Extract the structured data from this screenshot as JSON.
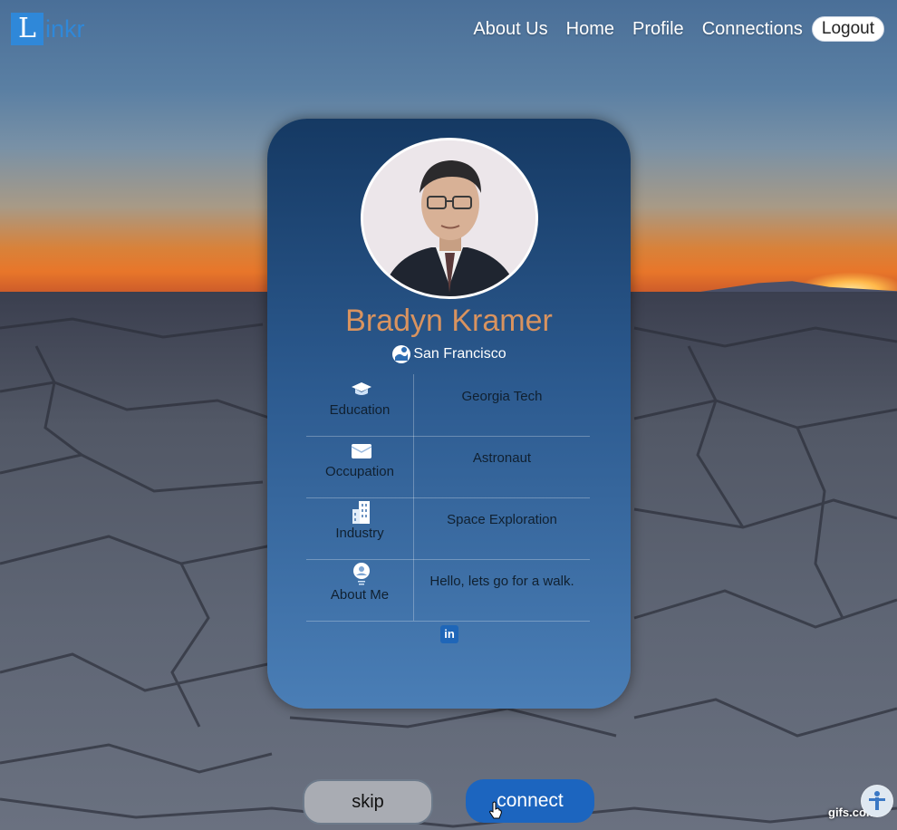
{
  "brand": {
    "letter": "L",
    "rest": "inkr"
  },
  "nav": {
    "links": [
      "About Us",
      "Home",
      "Profile",
      "Connections"
    ],
    "logout": "Logout"
  },
  "profile": {
    "name": "Bradyn Kramer",
    "location": "San Francisco",
    "rows": [
      {
        "icon": "graduation-cap-icon",
        "label": "Education",
        "value": "Georgia Tech"
      },
      {
        "icon": "envelope-icon",
        "label": "Occupation",
        "value": "Astronaut"
      },
      {
        "icon": "building-icon",
        "label": "Industry",
        "value": "Space Exploration"
      },
      {
        "icon": "person-badge-icon",
        "label": "About Me",
        "value": "Hello, lets go for a walk."
      }
    ],
    "social_label": "in"
  },
  "actions": {
    "skip": "skip",
    "connect": "connect"
  },
  "watermark": "gifs.com",
  "colors": {
    "brand": "#2f88d9",
    "name": "#d9935f",
    "connect": "#1c65bf"
  }
}
